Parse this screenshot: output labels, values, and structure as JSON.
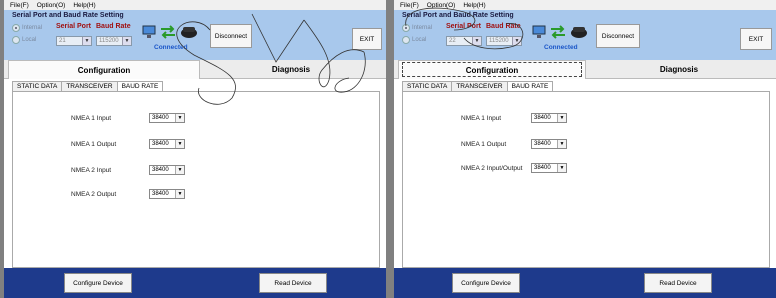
{
  "left": {
    "menu": [
      "File(F)",
      "Option(O)",
      "Help(H)"
    ],
    "header_title": "Serial Port and Baud Rate Setting",
    "radio_1": "Internal",
    "radio_2": "Local",
    "serial_port_label": "Serial Port",
    "baud_rate_label": "Baud Rate",
    "serial_port_value": "21",
    "baud_rate_value": "115200",
    "connected": "Connected",
    "disconnect": "Disconnect",
    "exit": "EXIT",
    "tab_configuration": "Configuration",
    "tab_diagnosis": "Diagnosis",
    "subtabs": [
      "STATIC DATA",
      "TRANSCEIVER",
      "BAUD RATE"
    ],
    "rows": [
      {
        "label": "NMEA 1 Input",
        "value": "38400"
      },
      {
        "label": "NMEA 1 Output",
        "value": "38400"
      },
      {
        "label": "NMEA 2 Input",
        "value": "38400"
      },
      {
        "label": "NMEA 2 Output",
        "value": "38400"
      }
    ],
    "configure": "Configure Device",
    "read": "Read Device"
  },
  "right": {
    "menu": [
      "File(F)",
      "Option(O)",
      "Help(H)"
    ],
    "header_title": "Serial Port and Baud Rate Setting",
    "radio_1": "Internal",
    "radio_2": "Local",
    "serial_port_label": "Serial Port",
    "baud_rate_label": "Baud Rate",
    "serial_port_value": "22",
    "baud_rate_value": "115200",
    "connected": "Connected",
    "disconnect": "Disconnect",
    "exit": "EXIT",
    "tab_configuration": "Configuration",
    "tab_diagnosis": "Diagnosis",
    "subtabs": [
      "STATIC DATA",
      "TRANSCEIVER",
      "BAUD RATE"
    ],
    "rows": [
      {
        "label": "NMEA 1 Input",
        "value": "38400"
      },
      {
        "label": "NMEA 1 Output",
        "value": "38400"
      },
      {
        "label": "NMEA 2 Input/Output",
        "value": "38400"
      }
    ],
    "configure": "Configure Device",
    "read": "Read Device"
  },
  "colors": {
    "header": "#a8c8ec",
    "footer": "#1e3a8c",
    "label_red": "#a01010",
    "connected": "#1a56c8"
  }
}
